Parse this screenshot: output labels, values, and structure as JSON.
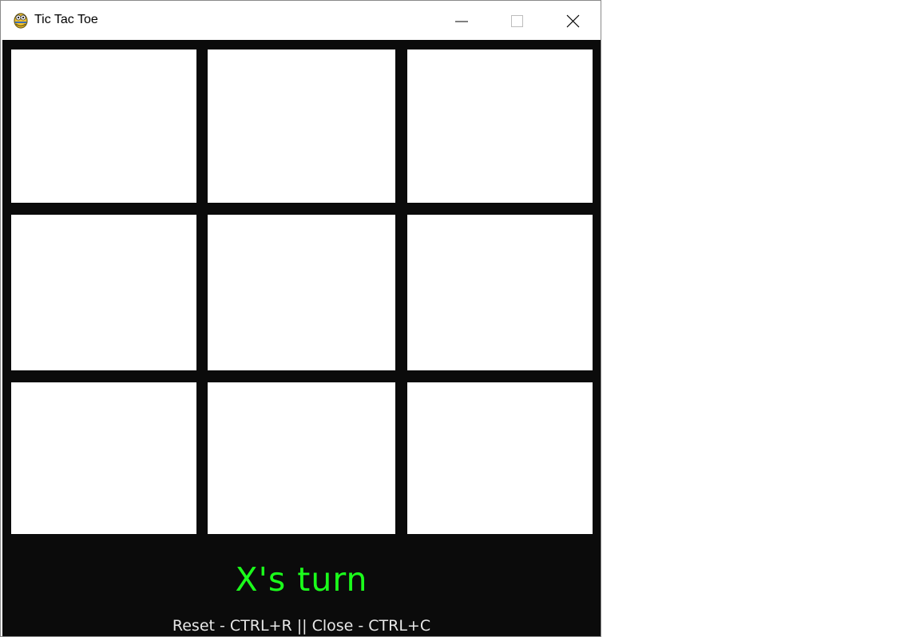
{
  "window": {
    "title": "Tic Tac Toe",
    "icon": "pygame-snake-icon",
    "controls": {
      "minimize": "minimize-icon",
      "maximize": "maximize-icon",
      "close": "close-icon"
    }
  },
  "game": {
    "board": [
      [
        "",
        "",
        ""
      ],
      [
        "",
        "",
        ""
      ],
      [
        "",
        "",
        ""
      ]
    ],
    "status": "X's turn",
    "hint": "Reset - CTRL+R || Close - CTRL+C",
    "colors": {
      "background": "#0b0b0b",
      "cell": "#ffffff",
      "status": "#1bff1b",
      "hint": "#e8e8e8"
    }
  }
}
